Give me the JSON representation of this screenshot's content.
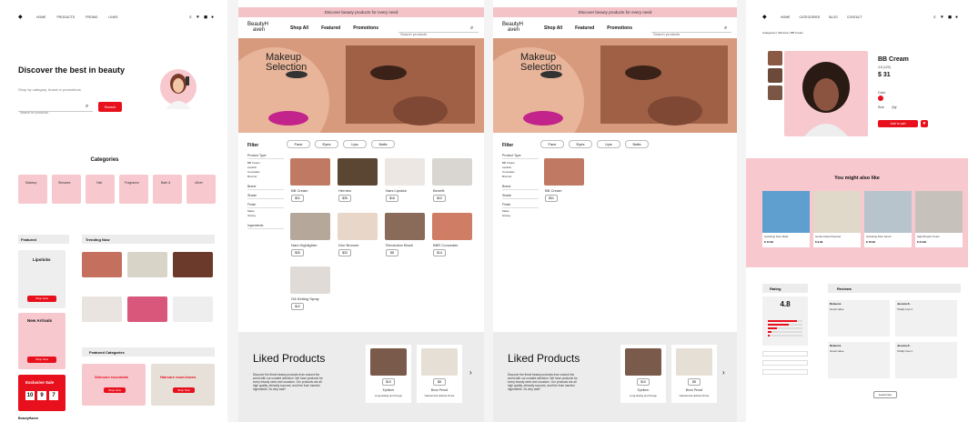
{
  "panel1": {
    "nav": [
      "HOME",
      "PRODUCTS",
      "PROMO",
      "LINKS"
    ],
    "hero_title": "Discover the best in beauty",
    "hero_sub": "Shop by category, brand or promotions",
    "search_placeholder": "Search for products...",
    "search_button": "Search",
    "categories_title": "Categories",
    "categories": [
      "Makeup",
      "Skincare",
      "Hair",
      "Fragrance",
      "Bath &",
      "Ulixel"
    ],
    "featured_title": "Featured",
    "trending_title": "Trending Now",
    "lipsticks": "Lipsticks",
    "shop_now": "Shop Now",
    "new_arrivals": "New Arrivals",
    "exclusive_sale": "Exclusive Sale",
    "countdown": [
      "10",
      "9",
      "7"
    ],
    "featured_categories_title": "Featured Categories",
    "skincare_essentials": "Skincare essentials",
    "haircare_must_haves": "Haircare must-haves",
    "footer_brand": "BeautyHaven"
  },
  "store": {
    "banner": "Discover beauty products for every need",
    "logo_line1": "BeautyH",
    "logo_line2": "aven",
    "nav": [
      "Shop All",
      "Featured",
      "Promotions"
    ],
    "search_placeholder": "Search products",
    "hero_title_line1": "Makeup",
    "hero_title_line2": "Selection",
    "filter_label": "Filter",
    "filter_tabs": [
      "Face",
      "Eyes",
      "Lips",
      "Nails"
    ],
    "sidebar_groups": [
      "Product Type",
      "Brand",
      "Shade",
      "Finish",
      "Ingredients"
    ],
    "product_types": [
      "BB Cream",
      "Lipstick",
      "Concealer",
      "Bronzer"
    ],
    "finishes": [
      "Matte",
      "Glossy"
    ],
    "liked_title": "Liked Products",
    "liked_desc_1": "Discover the finest beauty products from around the",
    "liked_desc_2": "world with our curated selection. We have products for",
    "liked_desc_3": "every beauty need and occasion. Our products are all",
    "liked_desc_4": "high quality, ethically sourced, and free from harmful",
    "liked_desc_5": "ingredients. So why wait?",
    "liked_items": [
      {
        "name": "Eyeliner",
        "price": "$10",
        "desc": "Long-lasting and thougn"
      },
      {
        "name": "Brow Pencil",
        "price": "$8",
        "desc": "Natural and defined brows"
      }
    ]
  },
  "panel2": {
    "products": [
      {
        "name": "BB Cream",
        "price": "$31"
      },
      {
        "name": "Hermes",
        "price": "$35"
      },
      {
        "name": "Nars Lipstick",
        "price": "$16"
      },
      {
        "name": "Benefit",
        "price": "$22"
      },
      {
        "name": "Nars Highlighter",
        "price": "$30"
      },
      {
        "name": "Dior Bronzer",
        "price": "$32"
      },
      {
        "name": "Revolution Blush",
        "price": "$8"
      },
      {
        "name": "BBR Concealer",
        "price": "$14"
      },
      {
        "name": "OA Setting Spray",
        "price": "$12"
      }
    ]
  },
  "panel3": {
    "products": [
      {
        "name": "BB Cream",
        "price": "$31"
      }
    ]
  },
  "panel4": {
    "nav": [
      "HOME",
      "CATEGORIES",
      "BLOG",
      "CONTACT"
    ],
    "breadcrumb": "Categories | Skincare | BB Cream",
    "product_name": "BB Cream",
    "rating_text": "4.8 (120)",
    "price": "$ 31",
    "color_label": "Color",
    "size_label": "Size",
    "qty_label": "Qty",
    "add_to_cart": "Add to cart",
    "also_like_title": "You might also like",
    "also_like": [
      {
        "name": "Hydrating Face Mask",
        "price": "$ 12.99"
      },
      {
        "name": "Gentle Facial Cleanser",
        "price": "$ 9.99"
      },
      {
        "name": "Hydrating Face Serum",
        "price": "$ 18.99"
      },
      {
        "name": "Night Repair Cream",
        "price": "$ 24.99"
      }
    ],
    "rating_title": "Rating",
    "rating_value": "4.8",
    "rating_bars": [
      0.85,
      0.6,
      0.25,
      0.1,
      0.05
    ],
    "reviews_title": "Reviews",
    "review_names": [
      "Rebecca",
      "Jessica K.",
      "Rebecca",
      "Jessica K."
    ],
    "review_titles": [
      "Great value",
      "Totally love it",
      "Great value",
      "Totally love it"
    ],
    "load_more": "Load more"
  },
  "colors": {
    "pink": "#f7c9cf",
    "red": "#e8101c",
    "banner": "#f4c3c8",
    "grey": "#ececec"
  }
}
